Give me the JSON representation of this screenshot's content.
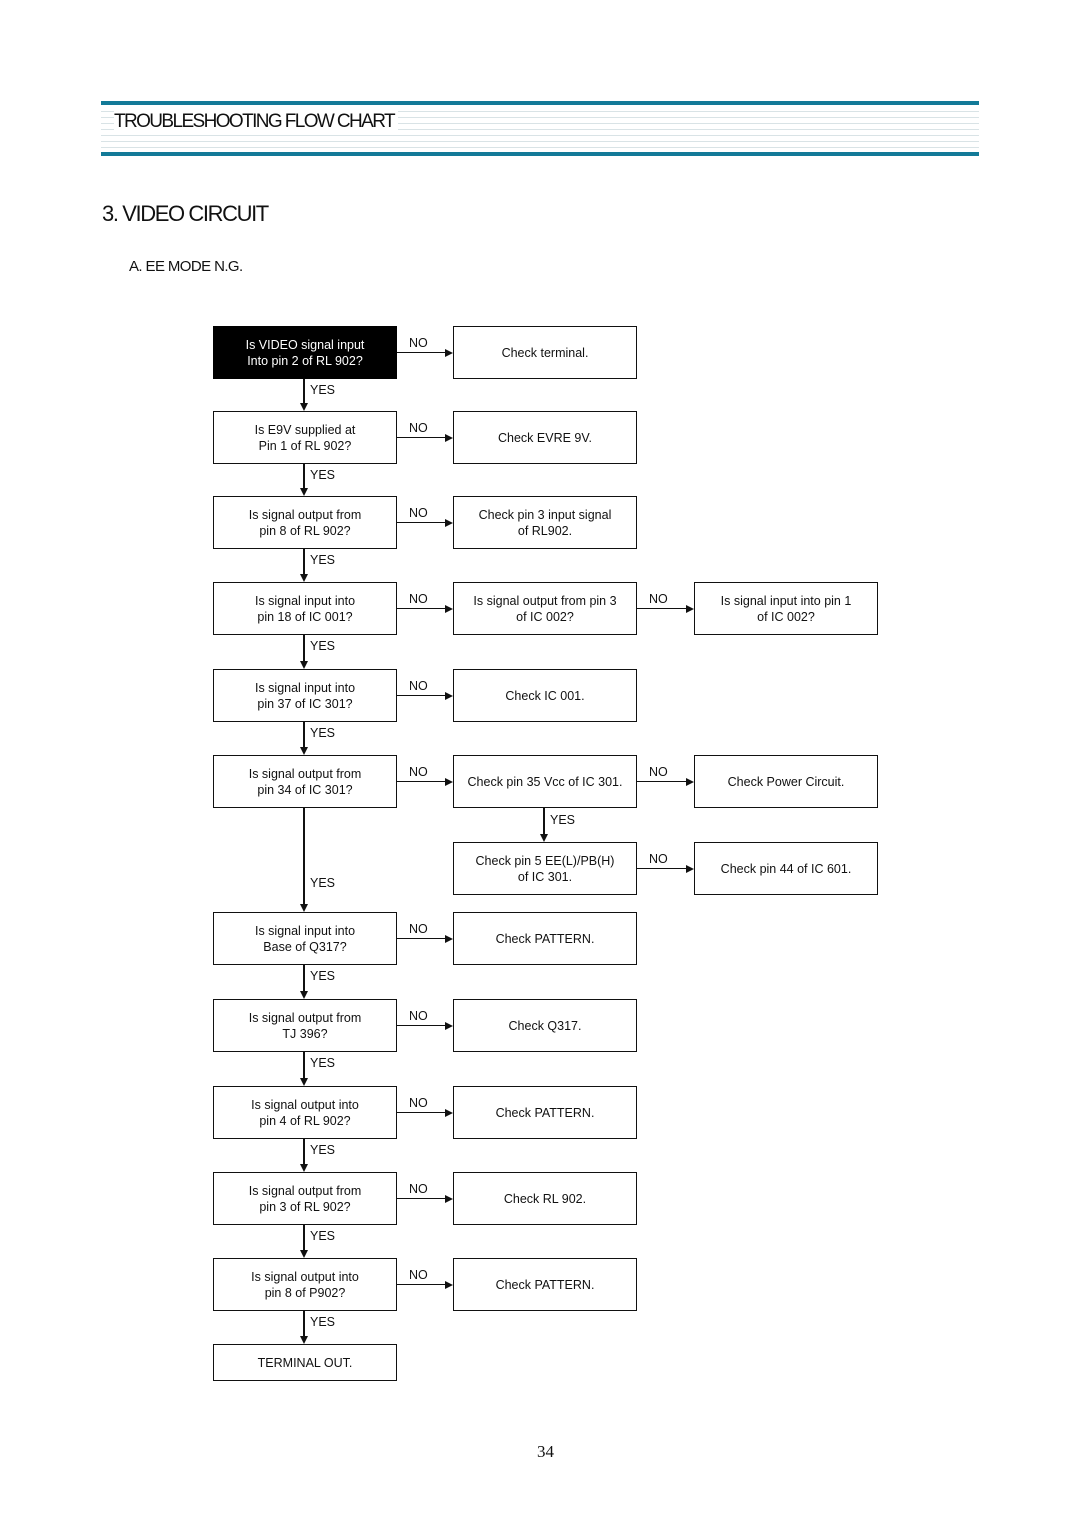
{
  "header": {
    "title": "TROUBLESHOOTING FLOW CHART",
    "accent_color": "#137a98"
  },
  "section_title": "3. VIDEO CIRCUIT",
  "subsection_title": "A. EE MODE N.G.",
  "flow_labels": {
    "yes": "YES",
    "no": "NO"
  },
  "main_steps": [
    {
      "text": "Is VIDEO signal  input\nInto pin 2 of RL 902?",
      "highlighted": true,
      "no_branch": [
        "Check terminal."
      ]
    },
    {
      "text": "Is E9V supplied at\nPin 1 of RL 902?",
      "no_branch": [
        "Check EVRE 9V."
      ]
    },
    {
      "text": "Is signal output from\npin 8 of RL 902?",
      "no_branch": [
        "Check pin 3 input signal\nof RL902."
      ]
    },
    {
      "text": "Is signal input into\npin 18 of IC 001?",
      "no_branch": [
        "Is signal output from pin 3\nof IC 002?",
        "Is signal input into pin 1\nof IC 002?"
      ]
    },
    {
      "text": "Is signal input into\npin 37 of IC 301?",
      "no_branch": [
        "Check IC 001."
      ]
    },
    {
      "text": "Is signal output from\npin 34 of IC 301?",
      "no_branch": [
        "Check pin 35 Vcc of IC 301.",
        "Check Power Circuit."
      ],
      "no_branch_yes": {
        "text": "Check  pin 5 EE(L)/PB(H)\nof IC 301.",
        "no": "Check pin 44 of IC 601."
      }
    },
    {
      "text": "Is signal input into\nBase of Q317?",
      "no_branch": [
        "Check PATTERN."
      ]
    },
    {
      "text": "Is signal output from\nTJ 396?",
      "no_branch": [
        "Check Q317."
      ]
    },
    {
      "text": "Is signal output into\npin 4 of RL 902?",
      "no_branch": [
        "Check PATTERN."
      ]
    },
    {
      "text": "Is signal output from\npin 3 of RL 902?",
      "no_branch": [
        "Check RL 902."
      ]
    },
    {
      "text": "Is signal output into\npin 8 of P902?",
      "no_branch": [
        "Check PATTERN."
      ]
    }
  ],
  "terminal": "TERMINAL OUT.",
  "page_number": "34"
}
